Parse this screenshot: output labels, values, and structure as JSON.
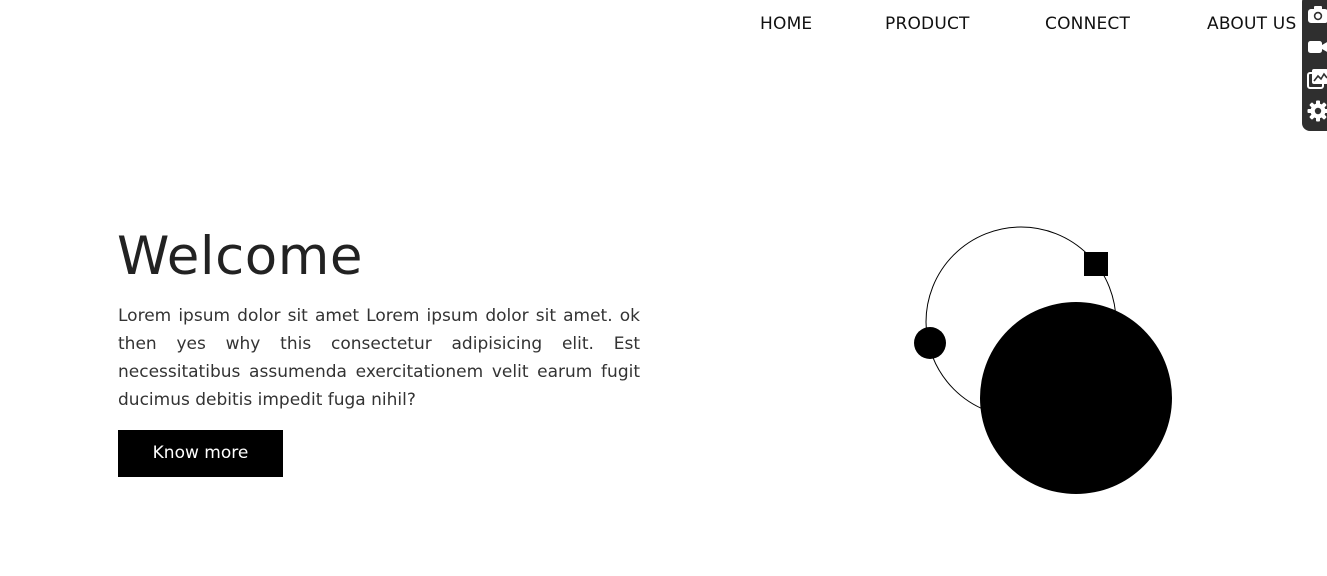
{
  "nav": {
    "items": [
      {
        "label": "HOME"
      },
      {
        "label": "PRODUCT"
      },
      {
        "label": "CONNECT"
      },
      {
        "label": "ABOUT US"
      }
    ]
  },
  "toolbar": {
    "icons": [
      "camera-icon",
      "video-icon",
      "gallery-icon",
      "gear-icon"
    ]
  },
  "hero": {
    "title": "Welcome",
    "text": "Lorem ipsum dolor sit amet Lorem ipsum dolor sit amet. ok then yes why this consectetur adipisicing elit. Est necessitatibus assumenda exercitationem velit earum fugit ducimus debitis impedit fuga nihil?",
    "button_label": "Know more"
  },
  "colors": {
    "background": "#ffffff",
    "text": "#222222",
    "button_bg": "#000000",
    "button_text": "#ffffff",
    "toolbar_bg": "#2f2f2f"
  }
}
